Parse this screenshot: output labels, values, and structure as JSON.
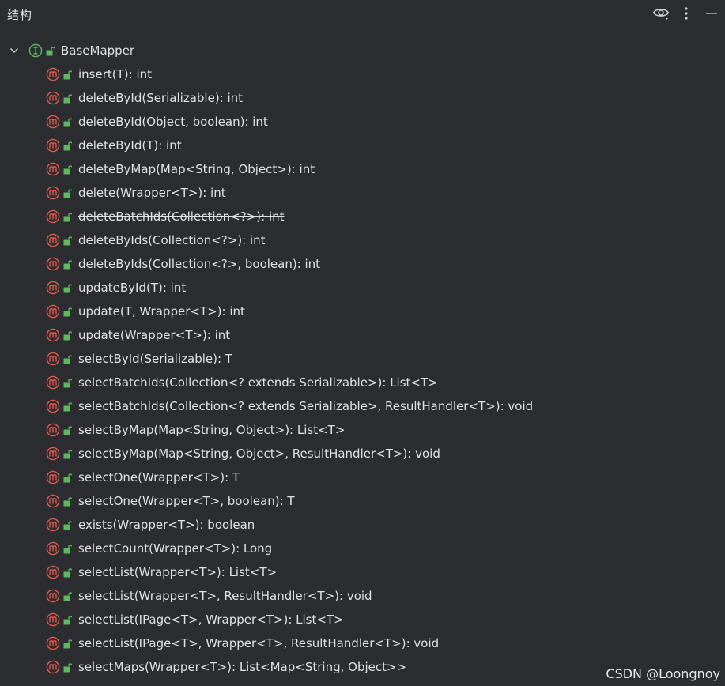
{
  "header": {
    "title": "结构",
    "icons": [
      "eye-icon",
      "more-vertical-icon",
      "minimize-icon"
    ]
  },
  "colors": {
    "background": "#2b2d30",
    "text": "#dfe1e5",
    "method_icon": "#e5574b",
    "interface_icon": "#5fb85f",
    "lock_icon": "#5fb85f"
  },
  "tree": {
    "root": {
      "label": "BaseMapper",
      "icon": "interface-icon",
      "expanded": true
    },
    "methods": [
      {
        "label": "insert(T): int",
        "deprecated": false
      },
      {
        "label": "deleteById(Serializable): int",
        "deprecated": false
      },
      {
        "label": "deleteById(Object, boolean): int",
        "deprecated": false
      },
      {
        "label": "deleteById(T): int",
        "deprecated": false
      },
      {
        "label": "deleteByMap(Map<String, Object>): int",
        "deprecated": false
      },
      {
        "label": "delete(Wrapper<T>): int",
        "deprecated": false
      },
      {
        "label": "deleteBatchIds(Collection<?>): int",
        "deprecated": true
      },
      {
        "label": "deleteByIds(Collection<?>): int",
        "deprecated": false
      },
      {
        "label": "deleteByIds(Collection<?>, boolean): int",
        "deprecated": false
      },
      {
        "label": "updateById(T): int",
        "deprecated": false
      },
      {
        "label": "update(T, Wrapper<T>): int",
        "deprecated": false
      },
      {
        "label": "update(Wrapper<T>): int",
        "deprecated": false
      },
      {
        "label": "selectById(Serializable): T",
        "deprecated": false
      },
      {
        "label": "selectBatchIds(Collection<? extends Serializable>): List<T>",
        "deprecated": false
      },
      {
        "label": "selectBatchIds(Collection<? extends Serializable>, ResultHandler<T>): void",
        "deprecated": false
      },
      {
        "label": "selectByMap(Map<String, Object>): List<T>",
        "deprecated": false
      },
      {
        "label": "selectByMap(Map<String, Object>, ResultHandler<T>): void",
        "deprecated": false
      },
      {
        "label": "selectOne(Wrapper<T>): T",
        "deprecated": false
      },
      {
        "label": "selectOne(Wrapper<T>, boolean): T",
        "deprecated": false
      },
      {
        "label": "exists(Wrapper<T>): boolean",
        "deprecated": false
      },
      {
        "label": "selectCount(Wrapper<T>): Long",
        "deprecated": false
      },
      {
        "label": "selectList(Wrapper<T>): List<T>",
        "deprecated": false
      },
      {
        "label": "selectList(Wrapper<T>, ResultHandler<T>): void",
        "deprecated": false
      },
      {
        "label": "selectList(IPage<T>, Wrapper<T>): List<T>",
        "deprecated": false
      },
      {
        "label": "selectList(IPage<T>, Wrapper<T>, ResultHandler<T>): void",
        "deprecated": false
      },
      {
        "label": "selectMaps(Wrapper<T>): List<Map<String, Object>>",
        "deprecated": false
      }
    ]
  },
  "watermark": "CSDN @Loongnoy"
}
